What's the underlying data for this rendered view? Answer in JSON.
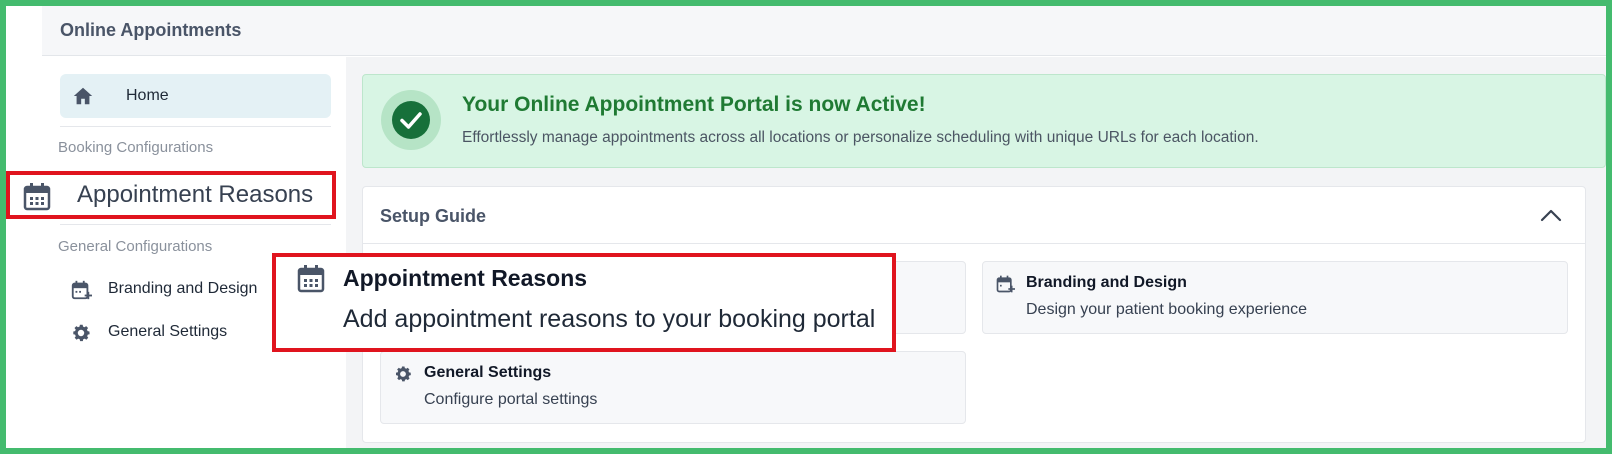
{
  "header": {
    "title": "Online Appointments"
  },
  "sidebar": {
    "home_label": "Home",
    "section_booking": "Booking Configurations",
    "section_general": "General Configurations",
    "items": [
      {
        "label": "Branding and Design",
        "icon": "calendar-plus-icon"
      },
      {
        "label": "General Settings",
        "icon": "gear-icon"
      }
    ]
  },
  "banner": {
    "headline": "Your Online Appointment Portal is now Active!",
    "subtitle": "Effortlessly manage appointments across all locations or personalize scheduling with unique URLs for each location."
  },
  "setup_guide": {
    "title": "Setup Guide",
    "tiles": [
      {
        "title": "Branding and Design",
        "description": "Design your patient booking experience",
        "icon": "calendar-plus-icon"
      },
      {
        "title": "General Settings",
        "description": "Configure portal settings",
        "icon": "gear-icon"
      }
    ]
  },
  "callouts": {
    "sidebar_item_label": "Appointment Reasons",
    "tile_title": "Appointment Reasons",
    "tile_description": "Add appointment reasons to your booking portal"
  },
  "colors": {
    "frame": "#44bb6e",
    "highlight": "#e0141e",
    "success": "#1f7a33",
    "banner_bg": "#d8f5e4"
  }
}
